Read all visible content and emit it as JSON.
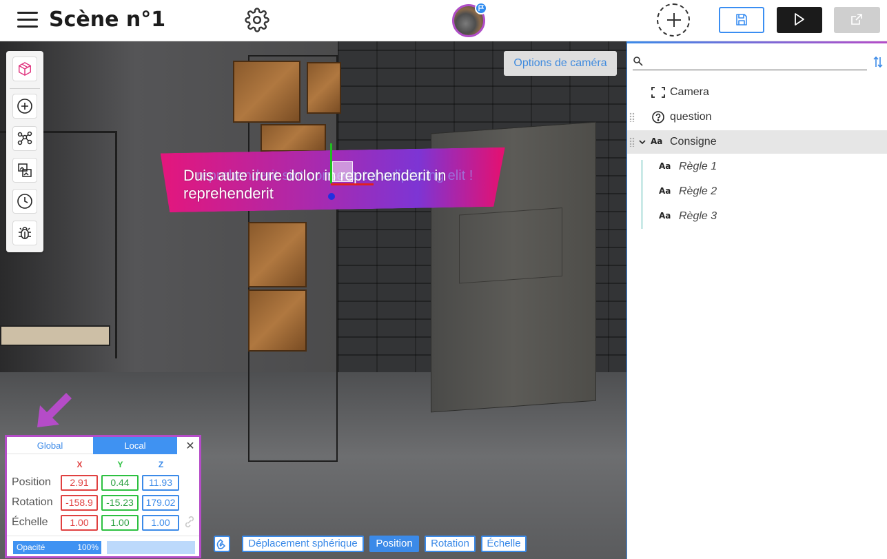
{
  "header": {
    "scene_title": "Scène n°1"
  },
  "viewport": {
    "camera_options_label": "Options de caméra",
    "banner_text": "Duis aute irure dolor in reprehenderit in reprehenderit",
    "banner_ghost_text": "reprehenderit sint consectetur adipiscing elit !"
  },
  "toolbar": {
    "tools": [
      "cube-icon",
      "add-circle-icon",
      "graph-nodes-icon",
      "image-swap-icon",
      "clock-icon",
      "bug-icon"
    ]
  },
  "transform_panel": {
    "tabs": {
      "global": "Global",
      "local": "Local"
    },
    "close": "✕",
    "axes": {
      "x": "X",
      "y": "Y",
      "z": "Z"
    },
    "rows": {
      "position": {
        "label": "Position",
        "x": "2.91",
        "y": "0.44",
        "z": "11.93"
      },
      "rotation": {
        "label": "Rotation",
        "x": "-158.9",
        "y": "-15.23",
        "z": "179.02"
      },
      "scale": {
        "label": "Échelle",
        "x": "1.00",
        "y": "1.00",
        "z": "1.00"
      }
    },
    "opacity": {
      "label": "Opacité",
      "value": "100%",
      "fraction": 1.0
    }
  },
  "modes": {
    "spherical": "Déplacement sphérique",
    "position": "Position",
    "rotation": "Rotation",
    "scale": "Échelle",
    "active": "position"
  },
  "hierarchy": {
    "search_placeholder": "",
    "items": [
      {
        "label": "Camera",
        "icon": "camera-frame-icon"
      },
      {
        "label": "question",
        "icon": "question-icon"
      },
      {
        "label": "Consigne",
        "icon": "text-icon",
        "expanded": true,
        "selected": true
      },
      {
        "label": "Règle 1",
        "icon": "text-icon"
      },
      {
        "label": "Règle 2",
        "icon": "text-icon"
      },
      {
        "label": "Règle 3",
        "icon": "text-icon"
      }
    ],
    "text_icon_glyph": "Aa"
  },
  "colors": {
    "accent": "#3b8ae8",
    "highlight": "#b54cc8",
    "x_axis": "#e04040",
    "y_axis": "#2cc040",
    "z_axis": "#3b8ae8"
  }
}
